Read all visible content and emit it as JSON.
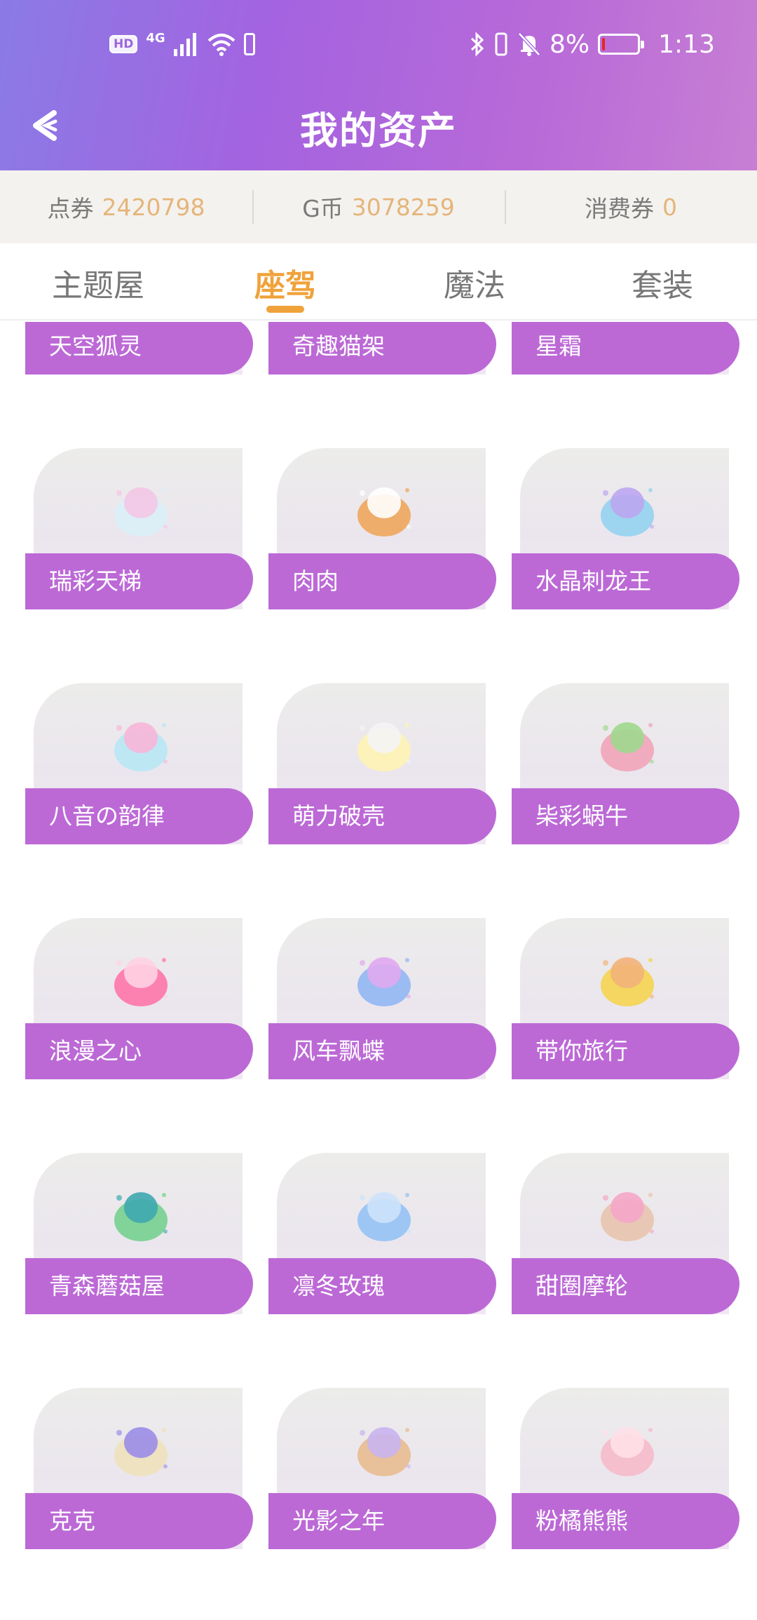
{
  "status_bar": {
    "hd": "HD",
    "network": "4G",
    "battery_percent": "8%",
    "time": "1:13",
    "battery_level": 0.08,
    "icons": [
      "hd-icon",
      "signal-icon",
      "wifi-icon",
      "phone-battery-icon",
      "bluetooth-icon",
      "vibrate-icon",
      "mute-bell-icon",
      "battery-icon"
    ]
  },
  "header": {
    "title": "我的资产",
    "back_icon": "back-arrow-icon"
  },
  "balances": [
    {
      "label": "点券",
      "value": "2420798"
    },
    {
      "label": "G币",
      "value": "3078259"
    },
    {
      "label": "消费券",
      "value": "0"
    }
  ],
  "tabs": [
    {
      "label": "主题屋",
      "active": false
    },
    {
      "label": "座驾",
      "active": true
    },
    {
      "label": "魔法",
      "active": false
    },
    {
      "label": "套装",
      "active": false
    }
  ],
  "colors": {
    "accent": "#f0a23b",
    "label_bg": "#bc69d6",
    "balance_value": "#e5b57a"
  },
  "items": [
    {
      "name": "天空狐灵",
      "art": "sky-fox-icon"
    },
    {
      "name": "奇趣猫架",
      "art": "cat-stand-icon"
    },
    {
      "name": "星霜",
      "art": "star-frost-icon"
    },
    {
      "name": "瑞彩天梯",
      "art": "winged-ladder-icon"
    },
    {
      "name": "肉肉",
      "art": "corgi-icon"
    },
    {
      "name": "水晶刺龙王",
      "art": "crystal-dragon-icon"
    },
    {
      "name": "八音の韵律",
      "art": "music-wings-icon"
    },
    {
      "name": "萌力破壳",
      "art": "egg-chick-icon"
    },
    {
      "name": "枈彩蜗牛",
      "art": "snail-icon"
    },
    {
      "name": "浪漫之心",
      "art": "heart-icon"
    },
    {
      "name": "风车飘蝶",
      "art": "pinwheel-butterfly-icon"
    },
    {
      "name": "带你旅行",
      "art": "scooter-bear-icon"
    },
    {
      "name": "青森蘑菇屋",
      "art": "mushroom-house-icon"
    },
    {
      "name": "凛冬玫瑰",
      "art": "ice-orb-icon"
    },
    {
      "name": "甜圈摩轮",
      "art": "donut-ferris-wheel-icon"
    },
    {
      "name": "克克",
      "art": "convertible-car-icon"
    },
    {
      "name": "光影之年",
      "art": "feather-icon"
    },
    {
      "name": "粉橘熊熊",
      "art": "pink-bear-icon"
    }
  ]
}
